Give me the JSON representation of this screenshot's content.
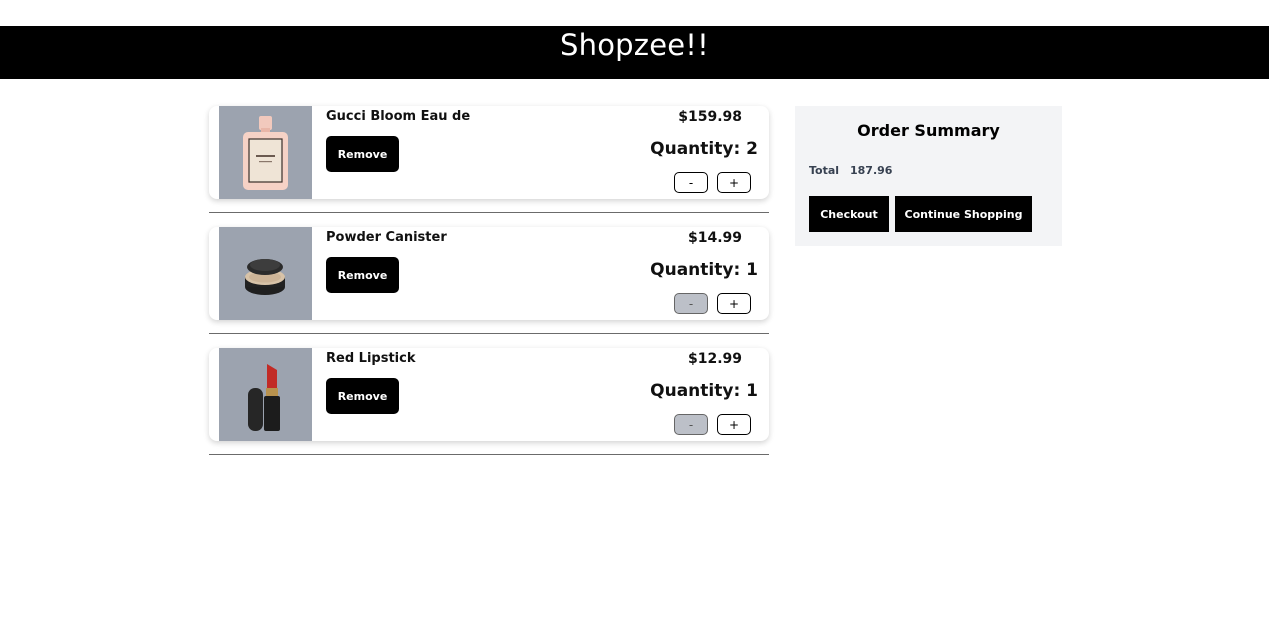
{
  "header": {
    "brand": "Shopzee!!"
  },
  "cart": {
    "items": [
      {
        "name": "Gucci Bloom Eau de",
        "remove_label": "Remove",
        "price": "$159.98",
        "quantity_text": "Quantity: 2",
        "minus_label": "-",
        "plus_label": "+",
        "image_icon": "perfume-bottle-icon"
      },
      {
        "name": "Powder Canister",
        "remove_label": "Remove",
        "price": "$14.99",
        "quantity_text": "Quantity: 1",
        "minus_label": "-",
        "plus_label": "+",
        "image_icon": "powder-canister-icon"
      },
      {
        "name": "Red Lipstick",
        "remove_label": "Remove",
        "price": "$12.99",
        "quantity_text": "Quantity: 1",
        "minus_label": "-",
        "plus_label": "+",
        "image_icon": "lipstick-icon"
      }
    ]
  },
  "summary": {
    "title": "Order Summary",
    "total_label": "Total",
    "total_value": "187.96",
    "checkout_label": "Checkout",
    "continue_label": "Continue Shopping"
  },
  "colors": {
    "header_bg": "#000000",
    "summary_bg": "#f3f4f6",
    "thumb_bg": "#9ca3af",
    "disabled_button": "#bcc0c8"
  }
}
